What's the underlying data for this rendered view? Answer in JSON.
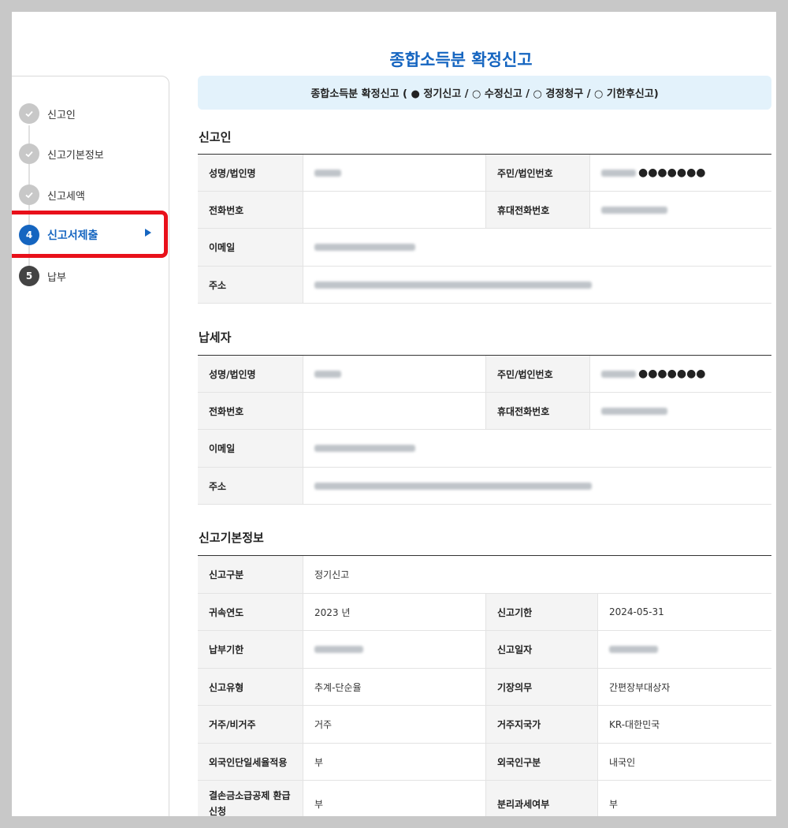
{
  "title": "종합소득분 확정신고",
  "banner": "종합소득분 확정신고 ( ● 정기신고 / ○ 수정신고 / ○ 경정청구 / ○ 기한후신고)",
  "steps": [
    {
      "number": "",
      "label": "신고인",
      "state": "done"
    },
    {
      "number": "",
      "label": "신고기본정보",
      "state": "done"
    },
    {
      "number": "",
      "label": "신고세액",
      "state": "done"
    },
    {
      "number": "4",
      "label": "신고서제출",
      "state": "active"
    },
    {
      "number": "5",
      "label": "납부",
      "state": "todo"
    }
  ],
  "reporter": {
    "heading": "신고인",
    "name_label": "성명/법인명",
    "id_label": "주민/법인번호",
    "id_mask": "●●●●●●●",
    "phone_label": "전화번호",
    "phone_value": "",
    "mobile_label": "휴대전화번호",
    "email_label": "이메일",
    "address_label": "주소"
  },
  "taxpayer": {
    "heading": "납세자",
    "name_label": "성명/법인명",
    "id_label": "주민/법인번호",
    "id_mask": "●●●●●●●",
    "phone_label": "전화번호",
    "phone_value": "",
    "mobile_label": "휴대전화번호",
    "email_label": "이메일",
    "address_label": "주소"
  },
  "basic": {
    "heading": "신고기본정보",
    "rows": [
      {
        "l1": "신고구분",
        "v1": "정기신고"
      },
      {
        "l1": "귀속연도",
        "v1": "2023 년",
        "l2": "신고기한",
        "v2": "2024-05-31"
      },
      {
        "l1": "납부기한",
        "v1": "",
        "l2": "신고일자",
        "v2": ""
      },
      {
        "l1": "신고유형",
        "v1": "추계-단순율",
        "l2": "기장의무",
        "v2": "간편장부대상자"
      },
      {
        "l1": "거주/비거주",
        "v1": "거주",
        "l2": "거주지국가",
        "v2": "KR-대한민국"
      },
      {
        "l1": "외국인단일세율적용",
        "v1": "부",
        "l2": "외국인구분",
        "v2": "내국인"
      },
      {
        "l1": "결손금소급공제 환급신청",
        "v1": "부",
        "l2": "분리과세여부",
        "v2": "부"
      }
    ]
  }
}
